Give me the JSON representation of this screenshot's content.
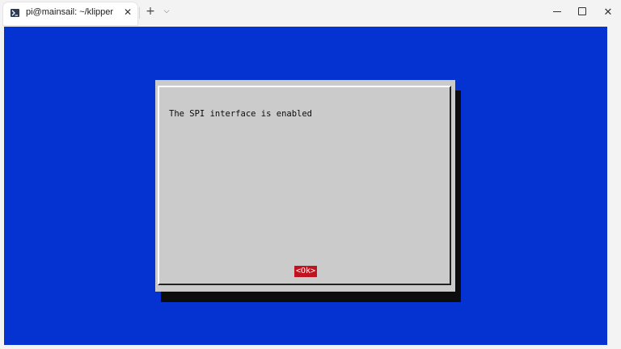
{
  "window": {
    "tab_title": "pi@mainsail: ~/klipper",
    "tab_icon": "terminal-icon",
    "tab_close_glyph": "✕",
    "new_tab_glyph": "+",
    "dropdown_glyph": "⌵",
    "close_glyph": "✕"
  },
  "colors": {
    "terminal_background": "#0433d1",
    "dialog_background": "#cbcbcb",
    "dialog_shadow": "#0d0d0d",
    "button_selected": "#c1121f"
  },
  "dialog": {
    "message": "The SPI interface is enabled",
    "ok_label": "<Ok>"
  }
}
